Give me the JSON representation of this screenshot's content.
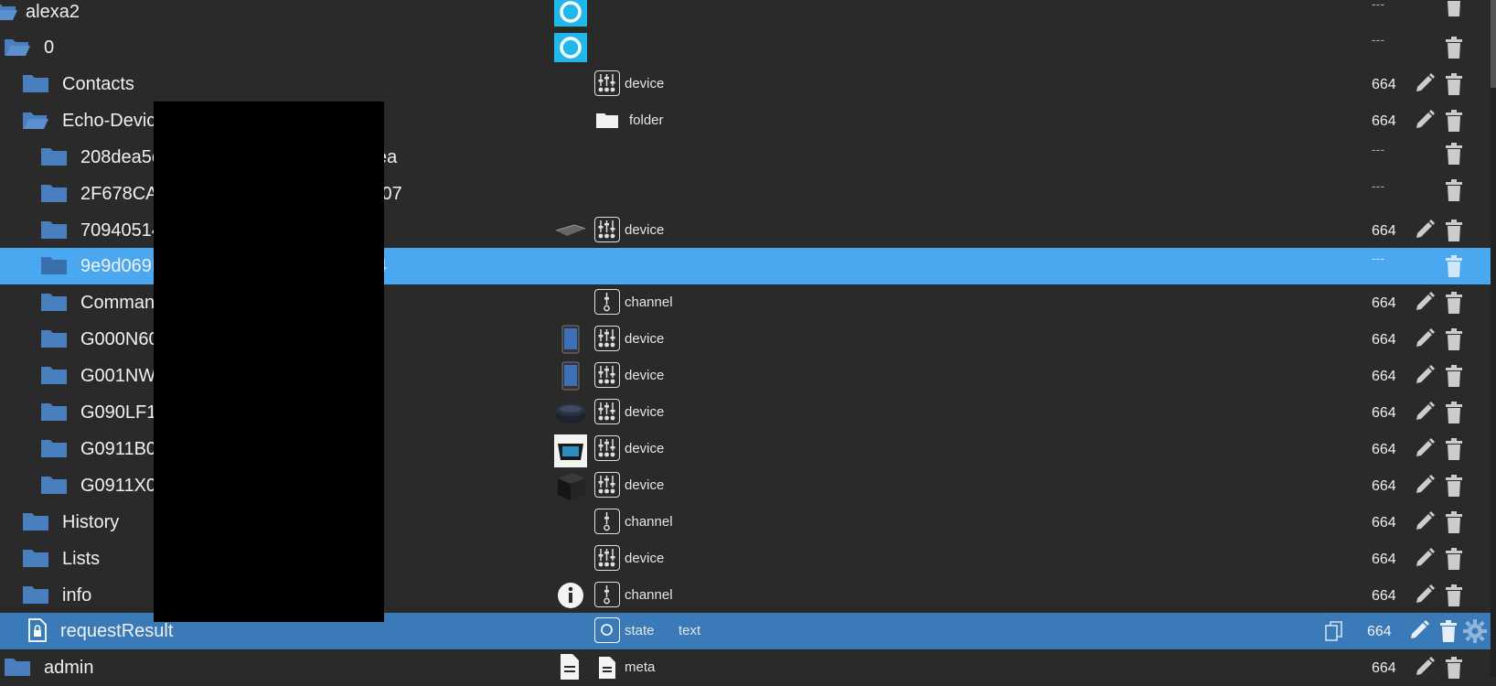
{
  "colors": {
    "background": "#2a2a2a",
    "folder": "#4a7fbf",
    "selected_row": "#4aa8f0",
    "focused_row": "#3a7ab8",
    "alexa_blue": "#1fb8e8"
  },
  "rows": [
    {
      "name": "alexa2",
      "role": "",
      "type": "",
      "acl": "---",
      "thumb": "alexa-logo",
      "folder_open": true
    },
    {
      "name": "0",
      "role": "",
      "type": "",
      "acl": "---",
      "thumb": "alexa-logo",
      "folder_open": true
    },
    {
      "name": "Contacts",
      "role": "device",
      "type": "",
      "acl": "664",
      "thumb": "",
      "role_icon": "device-icon"
    },
    {
      "name": "Echo-Devic",
      "role": "folder",
      "type": "",
      "acl": "664",
      "thumb": "",
      "role_icon": "folder-icon",
      "folder_open": true
    },
    {
      "name": "208dea5c",
      "role": "",
      "type": "",
      "acl": "---",
      "thumb": "",
      "suffix": "ea"
    },
    {
      "name": "2F678CA",
      "role": "",
      "type": "",
      "acl": "---",
      "thumb": "",
      "suffix": "I07"
    },
    {
      "name": "70940514",
      "role": "device",
      "type": "",
      "acl": "664",
      "thumb": "remote-thumb",
      "role_icon": "device-icon"
    },
    {
      "name": "9e9d069I",
      "role": "",
      "type": "",
      "acl": "---",
      "thumb": "",
      "suffix": "4"
    },
    {
      "name": "Comman",
      "role": "channel",
      "type": "",
      "acl": "664",
      "thumb": "",
      "role_icon": "channel-icon"
    },
    {
      "name": "G000N60",
      "role": "device",
      "type": "",
      "acl": "664",
      "thumb": "tablet-thumb",
      "role_icon": "device-icon"
    },
    {
      "name": "G001NW",
      "role": "device",
      "type": "",
      "acl": "664",
      "thumb": "tablet-thumb",
      "role_icon": "device-icon"
    },
    {
      "name": "G090LF1",
      "role": "device",
      "type": "",
      "acl": "664",
      "thumb": "echo-dot-thumb",
      "role_icon": "device-icon"
    },
    {
      "name": "G0911B0",
      "role": "device",
      "type": "",
      "acl": "664",
      "thumb": "echo-show-thumb",
      "role_icon": "device-icon"
    },
    {
      "name": "G0911X0",
      "role": "device",
      "type": "",
      "acl": "664",
      "thumb": "cube-thumb",
      "role_icon": "device-icon"
    },
    {
      "name": "History",
      "role": "channel",
      "type": "",
      "acl": "664",
      "thumb": "",
      "role_icon": "channel-icon"
    },
    {
      "name": "Lists",
      "role": "device",
      "type": "",
      "acl": "664",
      "thumb": "",
      "role_icon": "device-icon"
    },
    {
      "name": "info",
      "role": "channel",
      "type": "",
      "acl": "664",
      "thumb": "info-thumb",
      "role_icon": "channel-icon"
    },
    {
      "name": "requestResult",
      "role": "state",
      "type": "text",
      "acl": "664",
      "thumb": "",
      "role_icon": "state-icon"
    },
    {
      "name": "admin",
      "role": "meta",
      "type": "",
      "acl": "664",
      "thumb": "file-thumb",
      "role_icon": "meta-icon"
    }
  ]
}
